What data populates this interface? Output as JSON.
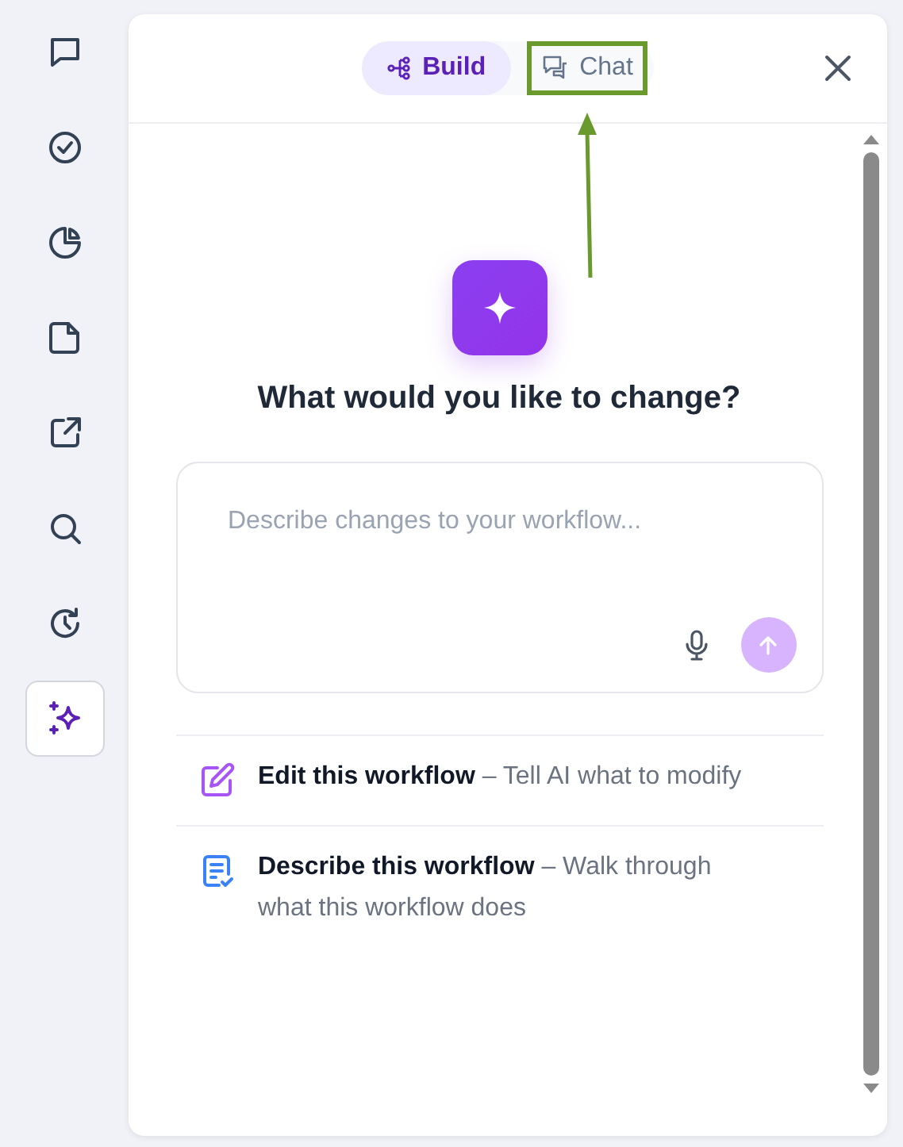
{
  "sidebar": {
    "items": [
      {
        "kind": "chat",
        "selected": false
      },
      {
        "kind": "check",
        "selected": false
      },
      {
        "kind": "pie",
        "selected": false
      },
      {
        "kind": "note",
        "selected": false
      },
      {
        "kind": "external",
        "selected": false
      },
      {
        "kind": "search",
        "selected": false
      },
      {
        "kind": "history",
        "selected": false
      },
      {
        "kind": "sparkle",
        "selected": true
      }
    ]
  },
  "panel": {
    "tabs": [
      {
        "kind": "build",
        "label": "Build",
        "selected": true,
        "highlighted": false
      },
      {
        "kind": "chat",
        "label": "Chat",
        "selected": false,
        "highlighted": true
      }
    ],
    "title": "What would you like to change?",
    "input": {
      "placeholder": "Describe changes to your workflow..."
    },
    "suggestions": [
      {
        "kind": "edit",
        "text": "**Edit this workflow** – Tell AI what to modify"
      },
      {
        "kind": "describe",
        "text": "**Describe this workflow** – Walk through what this workflow does"
      }
    ]
  }
}
